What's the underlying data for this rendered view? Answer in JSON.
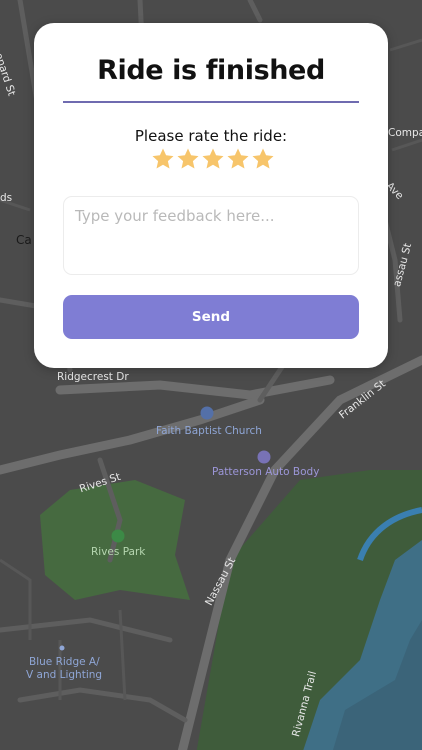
{
  "map": {
    "streets": [
      "Leonard St",
      "Ridgecrest Dr",
      "Franklin St",
      "Rives St",
      "Nassau St",
      "Rivanna Trail",
      "Ave",
      "assau St",
      "Compa",
      "ds",
      "Ca"
    ],
    "places": [
      "Faith Baptist Church",
      "Patterson Auto Body",
      "Rives Park",
      "Blue Ridge A/",
      "V and Lighting"
    ]
  },
  "modal": {
    "title": "Ride is finished",
    "rate_prompt": "Please rate the ride:",
    "rating": 5,
    "max_rating": 5,
    "star_color": "#f7c56b",
    "feedback": {
      "value": "",
      "placeholder": "Type your feedback here..."
    },
    "send_label": "Send",
    "accent_color": "#7f7dd4"
  }
}
